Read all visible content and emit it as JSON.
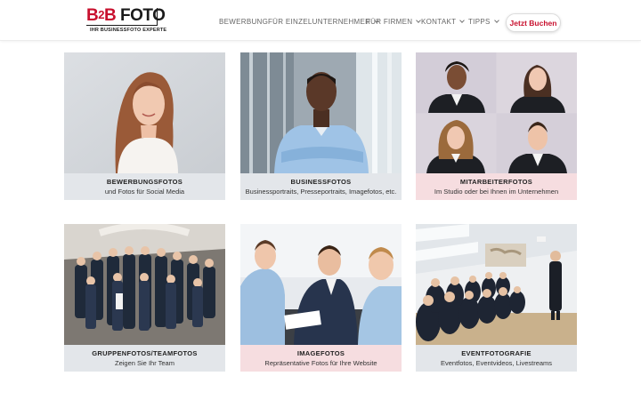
{
  "logo": {
    "brand_letter": "B",
    "brand_number": "2",
    "brand_letter2": "B",
    "brand_word": "FOTO",
    "tagline": "IHR BUSINESSFOTO EXPERTE"
  },
  "nav": {
    "items": [
      {
        "label": "BEWERBUNG",
        "has_dropdown": false
      },
      {
        "label": "FÜR EINZELUNTERNEHMER",
        "has_dropdown": true
      },
      {
        "label": "FÜR FIRMEN",
        "has_dropdown": true
      },
      {
        "label": "KONTAKT",
        "has_dropdown": true
      },
      {
        "label": "TIPPS",
        "has_dropdown": true
      }
    ],
    "cta_label": "Jetzt Buchen"
  },
  "cards": [
    {
      "title": "BEWERBUNGSFOTOS",
      "subtitle": "und Fotos für Social Media",
      "color": "grey",
      "image": "portrait-woman-smiling"
    },
    {
      "title": "BUSINESSFOTOS",
      "subtitle": "Businessportraits, Presseportraits, Imagefotos, etc.",
      "color": "grey",
      "image": "businessman-arms-crossed"
    },
    {
      "title": "MITARBEITERFOTOS",
      "subtitle": "Im Studio oder bei Ihnen im Unternehmen",
      "color": "pink",
      "image": "employee-headshots-grid"
    },
    {
      "title": "GRUPPENFOTOS/TEAMFOTOS",
      "subtitle": "Zeigen Sie Ihr Team",
      "color": "grey",
      "image": "team-group-photo"
    },
    {
      "title": "IMAGEFOTOS",
      "subtitle": "Repräsentative Fotos für Ihre Website",
      "color": "pink",
      "image": "meeting-handshake"
    },
    {
      "title": "EVENTFOTOGRAFIE",
      "subtitle": "Eventfotos, Eventvideos, Livestreams",
      "color": "grey",
      "image": "conference-audience"
    }
  ],
  "colors": {
    "accent": "#c8102e",
    "caption_grey": "#e3e6ea",
    "caption_pink": "#f6dde0"
  }
}
